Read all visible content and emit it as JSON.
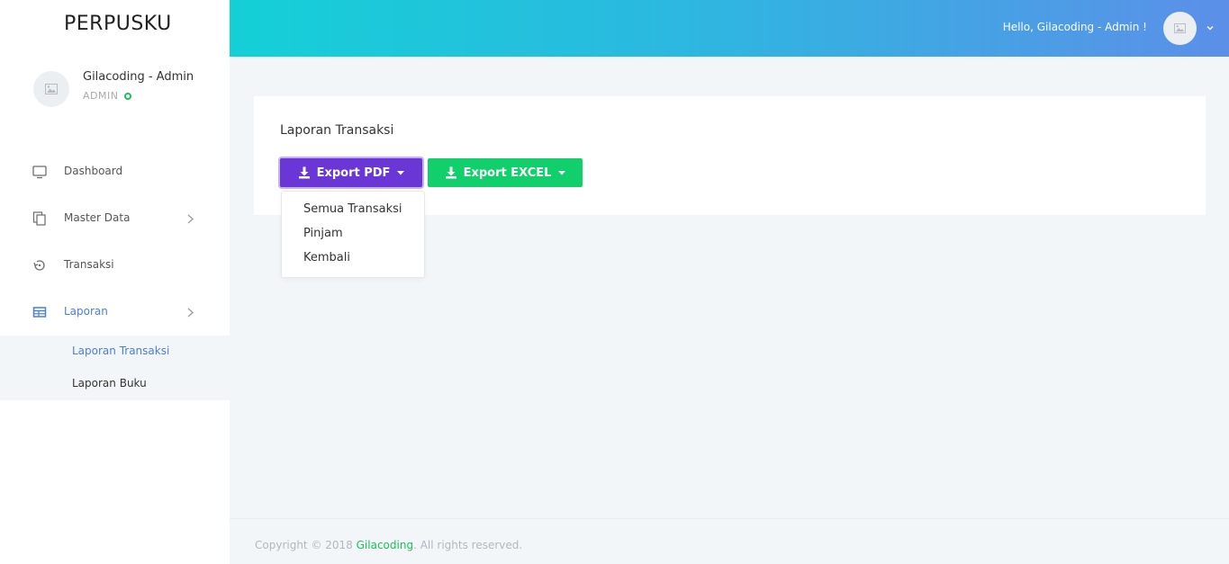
{
  "app": {
    "brand": "PERPUSKU"
  },
  "profile": {
    "name": "Gilacoding - Admin",
    "role": "ADMIN"
  },
  "sidebar": {
    "items": [
      {
        "label": "Dashboard",
        "icon": "monitor-icon"
      },
      {
        "label": "Master Data",
        "icon": "copy-icon"
      },
      {
        "label": "Transaksi",
        "icon": "history-icon"
      },
      {
        "label": "Laporan",
        "icon": "table-icon"
      }
    ],
    "submenu": [
      {
        "label": "Laporan Transaksi"
      },
      {
        "label": "Laporan Buku"
      }
    ]
  },
  "topbar": {
    "greeting": "Hello, Gilacoding - Admin !"
  },
  "card": {
    "title": "Laporan Transaksi",
    "export_pdf_label": "Export PDF",
    "export_excel_label": "Export EXCEL"
  },
  "dropdown": {
    "items": [
      {
        "label": "Semua Transaksi"
      },
      {
        "label": "Pinjam"
      },
      {
        "label": "Kembali"
      }
    ]
  },
  "footer": {
    "prefix": "Copyright © 2018 ",
    "link": "Gilacoding",
    "suffix": ". All rights reserved."
  },
  "colors": {
    "accent_purple": "#6a36d6",
    "accent_green": "#11cf6b",
    "active_blue": "#4a7fd6",
    "online_green": "#1bc15a"
  }
}
